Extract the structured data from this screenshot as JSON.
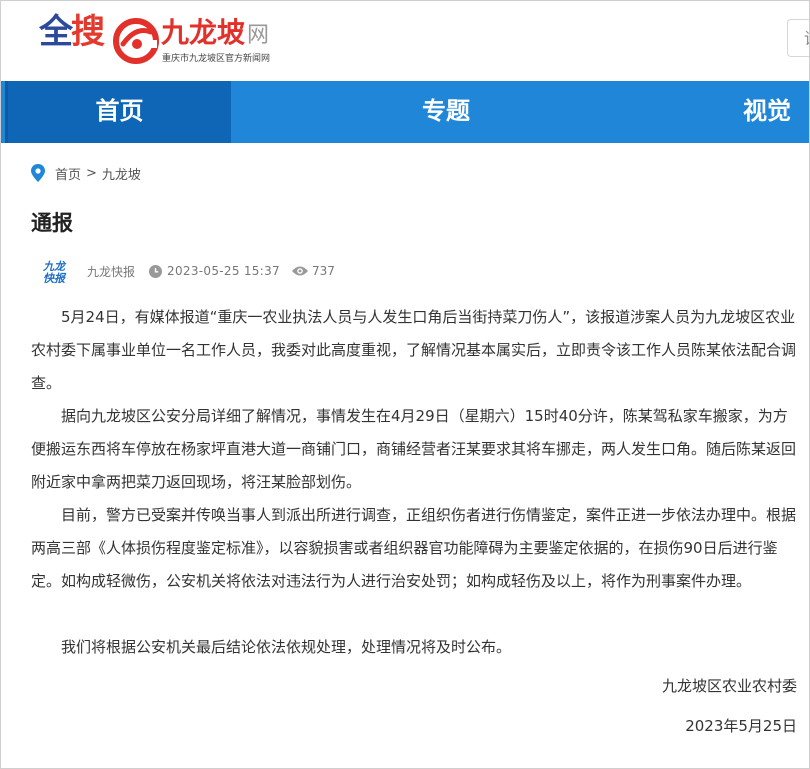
{
  "header": {
    "logo_quansou_1": "全",
    "logo_quansou_2": "搜",
    "site_name": "九龙坡",
    "site_suffix": "网",
    "site_subtitle": "重庆市九龙坡区官方新闻网",
    "search_peek": "请"
  },
  "nav": {
    "items": [
      {
        "label": "首页",
        "active": true
      },
      {
        "label": "专题",
        "active": false
      },
      {
        "label": "视觉",
        "active": false
      }
    ]
  },
  "breadcrumb": {
    "home": "首页",
    "separator": ">",
    "current": "九龙坡"
  },
  "article": {
    "title": "通报",
    "author_logo_line1": "九龙",
    "author_logo_line2": "快报",
    "author": "九龙快报",
    "published": "2023-05-25 15:37",
    "views": "737",
    "paragraphs": [
      "5月24日，有媒体报道“重庆一农业执法人员与人发生口角后当街持菜刀伤人”，该报道涉案人员为九龙坡区农业农村委下属事业单位一名工作人员，我委对此高度重视，了解情况基本属实后，立即责令该工作人员陈某依法配合调查。",
      "据向九龙坡区公安分局详细了解情况，事情发生在4月29日（星期六）15时40分许，陈某驾私家车搬家，为方便搬运东西将车停放在杨家坪直港大道一商铺门口，商铺经营者汪某要求其将车挪走，两人发生口角。随后陈某返回附近家中拿两把菜刀返回现场，将汪某脸部划伤。",
      "目前，警方已受案并传唤当事人到派出所进行调查，正组织伤者进行伤情鉴定，案件正进一步依法办理中。根据两高三部《人体损伤程度鉴定标准》，以容貌损害或者组织器官功能障碍为主要鉴定依据的，在损伤90日后进行鉴定。如构成轻微伤，公安机关将依法对违法行为人进行治安处罚；如构成轻伤及以上，将作为刑事案件办理。",
      "我们将根据公安机关最后结论依法依规处理，处理情况将及时公布。"
    ],
    "signature_org": "九龙坡区农业农村委",
    "signature_date": "2023年5月25日"
  },
  "colors": {
    "nav_bg": "#1f86d8",
    "nav_active_bg": "#0f66b6",
    "brand_red": "#e2302b",
    "brand_blue": "#2b4a9b"
  },
  "icons": [
    "location-pin-icon",
    "clock-icon",
    "eye-icon"
  ]
}
